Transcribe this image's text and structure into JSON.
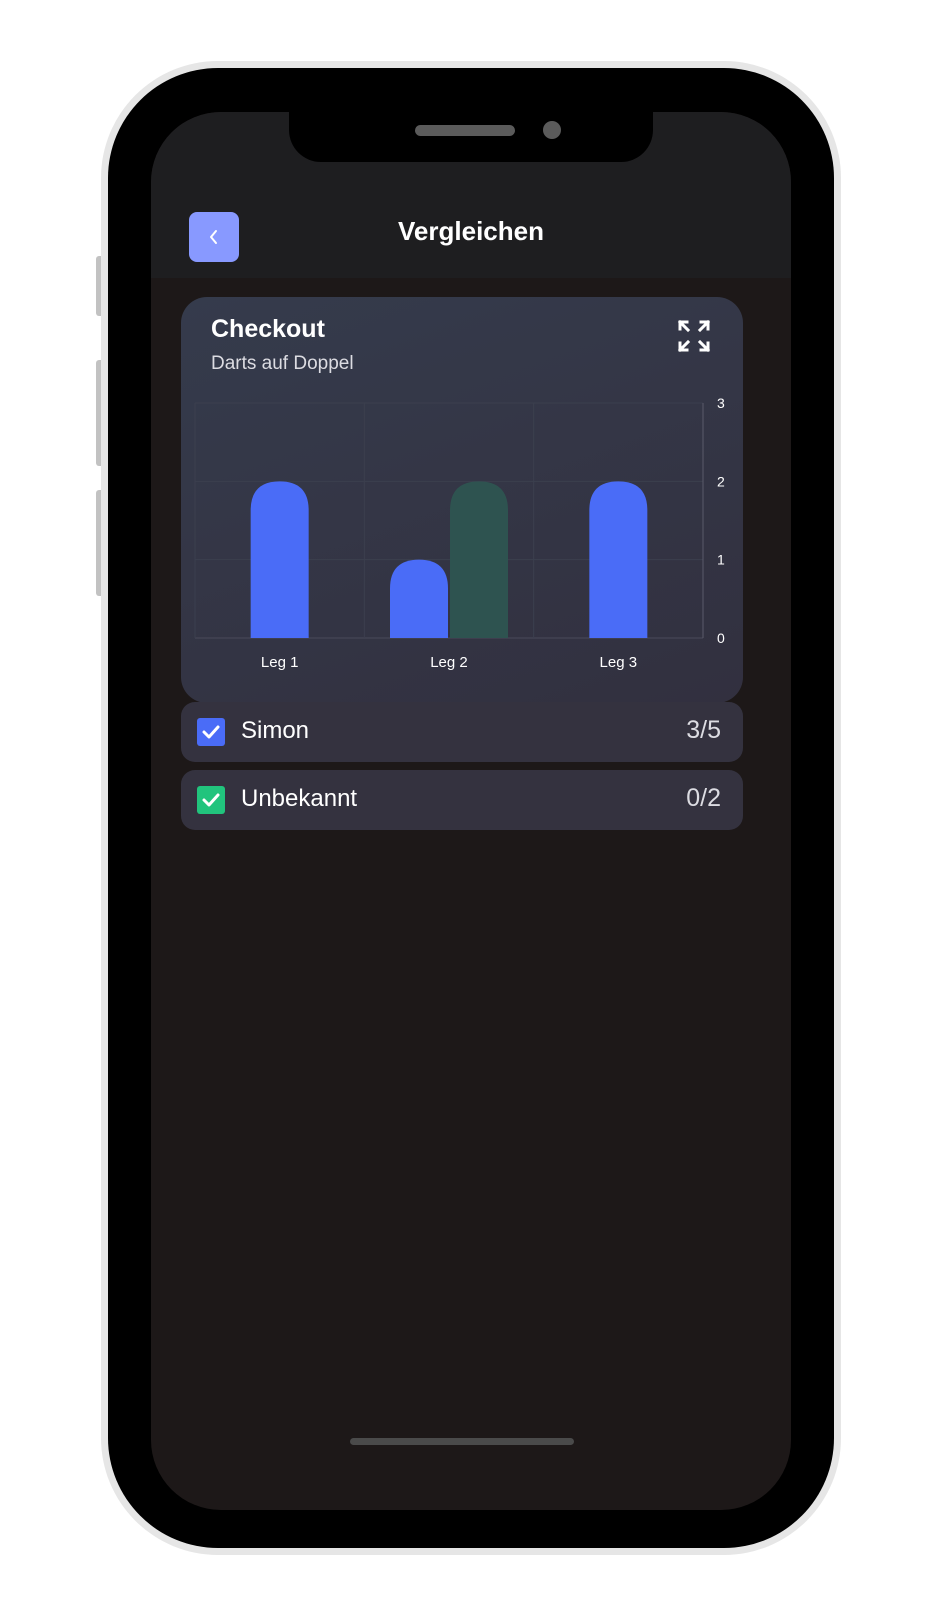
{
  "header": {
    "title": "Vergleichen",
    "back_icon": "chevron-left-icon"
  },
  "card": {
    "title": "Checkout",
    "subtitle": "Darts auf Doppel",
    "expand_icon": "expand-icon"
  },
  "chart_data": {
    "type": "bar",
    "categories": [
      "Leg 1",
      "Leg 2",
      "Leg 3"
    ],
    "series": [
      {
        "values": [
          2,
          1,
          2
        ],
        "color": "#4a6cf7"
      },
      {
        "values": [
          null,
          2,
          null
        ],
        "color": "#2e5350"
      }
    ],
    "ylim": [
      0,
      3
    ],
    "yticks": [
      "0",
      "1",
      "2",
      "3"
    ],
    "y_axis_side": "right",
    "grid": true
  },
  "players": [
    {
      "name": "Simon",
      "score": "3/5",
      "checked": true,
      "color": "#4a6cf7"
    },
    {
      "name": "Unbekannt",
      "score": "0/2",
      "checked": true,
      "color": "#21c47d"
    }
  ]
}
